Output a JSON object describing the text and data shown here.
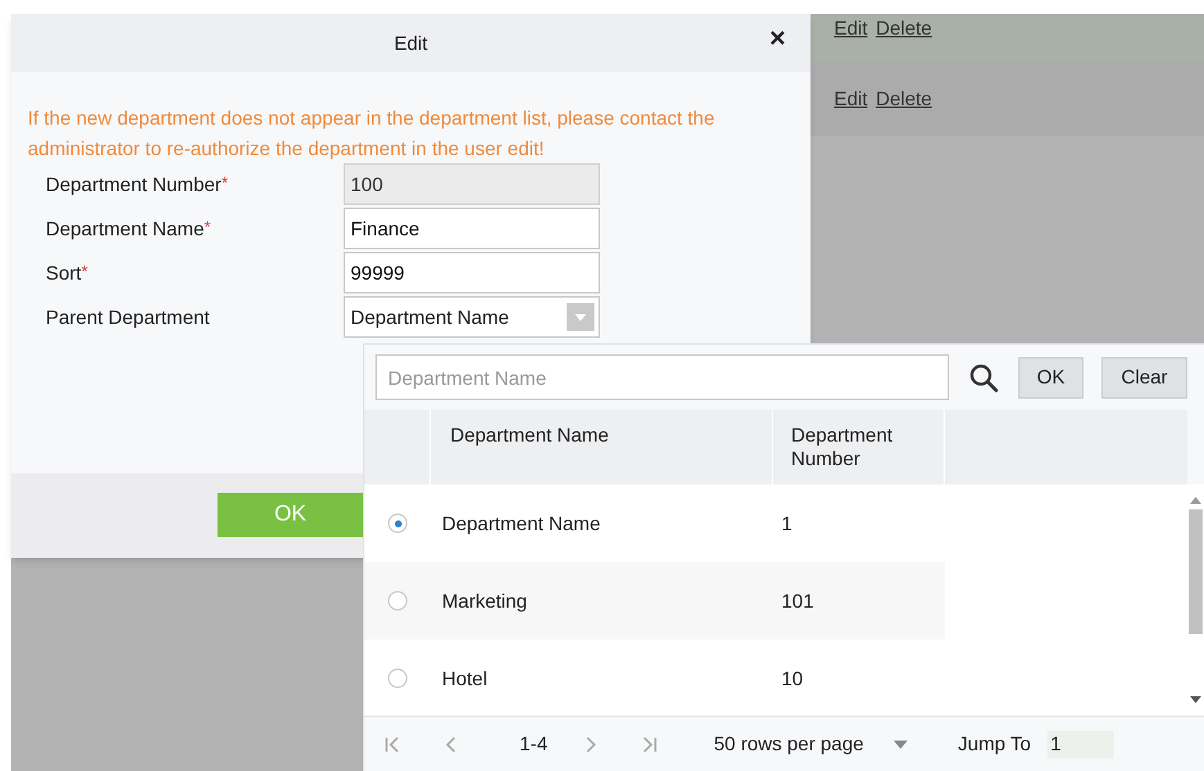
{
  "background_rows": [
    {
      "highlighted": true,
      "links": [
        "Edit",
        "Delete"
      ]
    },
    {
      "highlighted": false,
      "links": [
        "Edit",
        "Delete"
      ]
    }
  ],
  "dialog": {
    "title": "Edit",
    "close": "×",
    "notice": "If the new department does not appear in the department list, please contact the administrator to re-authorize the department in the user edit!",
    "fields": [
      {
        "kind": "text",
        "label": "Department Number",
        "required_mark": "*",
        "value": "100",
        "disabled": true
      },
      {
        "kind": "text",
        "label": "Department Name",
        "required_mark": "*",
        "value": "Finance",
        "disabled": false
      },
      {
        "kind": "text",
        "label": "Sort",
        "required_mark": "*",
        "value": "99999",
        "disabled": false
      },
      {
        "kind": "select",
        "label": "Parent Department",
        "value": "Department Name"
      }
    ],
    "ok_button": "OK"
  },
  "picker": {
    "search_placeholder": "Department Name",
    "ok_button": "OK",
    "clear_button": "Clear",
    "columns": [
      "Department Name",
      "Department Number"
    ],
    "rows": [
      {
        "selected": true,
        "cells": [
          "Department Name",
          "1"
        ]
      },
      {
        "selected": false,
        "cells": [
          "Marketing",
          "101"
        ]
      },
      {
        "selected": false,
        "cells": [
          "Hotel",
          "10"
        ]
      }
    ],
    "pager": {
      "range": "1-4",
      "rows_per_page": "50 rows per page",
      "jump_label": "Jump To",
      "jump_value": "1"
    }
  }
}
